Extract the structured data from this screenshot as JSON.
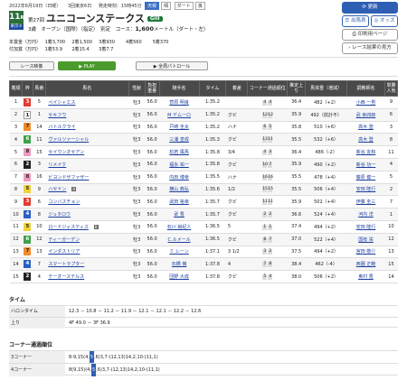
{
  "race_info": {
    "date": "2022年6月19日（日曜）",
    "meeting": "3回東京6日",
    "post_time": "発走時刻：15時45分",
    "weather": "天候",
    "weather_value": "晴",
    "track": "ダート",
    "track_value": "良"
  },
  "race": {
    "number": "11",
    "number_suffix": "R",
    "nth": "第27回",
    "name": "ユニコーンステークス",
    "grade": "GIII",
    "grade_badge": "東京⑤",
    "conditions": "3歳　オープン（国際）（指定）　別定　コース：",
    "distance": "1,600",
    "course_suffix": "メートル（ダート・左）"
  },
  "prize": {
    "row1_label": "本賞金（万円）",
    "row1": [
      "1着",
      "3,700",
      "2着",
      "1,500",
      "3着",
      "930",
      "4着",
      "560",
      "5着",
      "370"
    ],
    "row2_label": "付加賞（万円）",
    "row2": [
      "1着",
      "53.9",
      "2着",
      "15.4",
      "3着",
      "7.7"
    ]
  },
  "buttons": {
    "update": "更新",
    "entries": "出馬表",
    "odds": "オッズ",
    "print": "印刷用ページ",
    "results_howto": "レース結果の見方"
  },
  "tabs": {
    "race_video": "レース映像",
    "play": "PLAY",
    "patrol": "全周パトロール"
  },
  "table_headers": [
    "着順",
    "枠",
    "馬番",
    "馬名",
    "性齢",
    "負担重量",
    "騎手名",
    "タイム",
    "着差",
    "コーナー通過順位",
    "推定上り",
    "馬体重（増減）",
    "調教師名",
    "単勝人気"
  ],
  "results": [
    {
      "pos": "1",
      "waku": "3",
      "num": "5",
      "name": "ペイシャエス",
      "sex": "牡3",
      "wt": "56.0",
      "jockey": "菅原 明良",
      "time": "1:35.2",
      "margin": "",
      "corners": [
        "4",
        "4"
      ],
      "up": "36.4",
      "bw": "482（+2）",
      "trainer": "小西 一男",
      "pop": "9"
    },
    {
      "pos": "2",
      "waku": "1",
      "num": "1",
      "name": "セキフウ",
      "sex": "牡3",
      "wt": "56.0",
      "jockey": "M.デムーロ",
      "time": "1:35.2",
      "margin": "クビ",
      "corners": [
        "12",
        "12"
      ],
      "up": "35.9",
      "bw": "492（前計不）",
      "trainer": "武 幸四郎",
      "pop": "6"
    },
    {
      "pos": "3",
      "waku": "7",
      "num": "14",
      "name": "バトルクライ",
      "sex": "牡3",
      "wt": "56.0",
      "jockey": "戸崎 圭太",
      "time": "1:35.2",
      "margin": "ハナ",
      "corners": [
        "6",
        "5"
      ],
      "up": "35.8",
      "bw": "510（+6）",
      "trainer": "高木 登",
      "pop": "3"
    },
    {
      "pos": "4",
      "waku": "6",
      "num": "11",
      "name": "ヴァルツァーシャル",
      "sex": "牡3",
      "wt": "56.0",
      "jockey": "三浦 皇成",
      "time": "1:35.3",
      "margin": "クビ",
      "corners": [
        "13",
        "11"
      ],
      "up": "35.5",
      "bw": "532（+6）",
      "trainer": "高木 登",
      "pop": "8"
    },
    {
      "pos": "5",
      "waku": "8",
      "num": "15",
      "name": "セイウンオセアン",
      "sex": "牡3",
      "wt": "56.0",
      "jockey": "松若 風馬",
      "time": "1:35.8",
      "margin": "3/4",
      "corners": [
        "4",
        "3"
      ],
      "up": "36.4",
      "bw": "486（-2）",
      "trainer": "新谷 友和",
      "pop": "11"
    },
    {
      "pos": "6",
      "waku": "2",
      "num": "3",
      "name": "リメイク",
      "sex": "牡3",
      "wt": "56.0",
      "jockey": "福永 祐一",
      "time": "1:35.8",
      "margin": "クビ",
      "corners": [
        "10",
        "7"
      ],
      "up": "35.9",
      "bw": "490（+2）",
      "trainer": "新谷 功一",
      "pop": "4"
    },
    {
      "pos": "7",
      "waku": "8",
      "num": "16",
      "name": "ビヨンドザファザー",
      "sex": "牡3",
      "wt": "56.0",
      "jockey": "内田 博幸",
      "time": "1:35.5",
      "margin": "ハナ",
      "corners": [
        "16",
        "16"
      ],
      "up": "35.5",
      "bw": "478（+4）",
      "trainer": "藤原 健一",
      "pop": "5"
    },
    {
      "pos": "8",
      "waku": "5",
      "num": "9",
      "name": "ハセドン",
      "sex": "牡3",
      "wt": "56.0",
      "jockey": "横山 典弘",
      "time": "1:35.6",
      "margin": "1/2",
      "corners": [
        "15",
        "15"
      ],
      "up": "35.5",
      "bw": "506（+4）",
      "trainer": "安田 隆行",
      "pop": "2",
      "blinker": "B"
    },
    {
      "pos": "9",
      "waku": "3",
      "num": "6",
      "name": "コンバスチョン",
      "sex": "牡3",
      "wt": "56.0",
      "jockey": "武田 裕幸",
      "time": "1:35.7",
      "margin": "クビ",
      "corners": [
        "11",
        "11"
      ],
      "up": "35.9",
      "bw": "502（+4）",
      "trainer": "伊藤 圭三",
      "pop": "7"
    },
    {
      "pos": "10",
      "waku": "4",
      "num": "8",
      "name": "ジュタロウ",
      "sex": "牡3",
      "wt": "56.0",
      "jockey": "武 豊",
      "time": "1:35.7",
      "margin": "クビ",
      "corners": [
        "2",
        "2"
      ],
      "up": "36.6",
      "bw": "524（+4）",
      "trainer": "河内 洋",
      "pop": "1"
    },
    {
      "pos": "11",
      "waku": "5",
      "num": "10",
      "name": "ロードジャスティス",
      "sex": "牡3",
      "wt": "56.0",
      "jockey": "石川 裕紀人",
      "time": "1:36.5",
      "margin": "5",
      "corners": [
        "1",
        "1"
      ],
      "up": "37.4",
      "bw": "494（+2）",
      "trainer": "安田 隆行",
      "pop": "10",
      "blinker": "B"
    },
    {
      "pos": "12",
      "waku": "6",
      "num": "12",
      "name": "ティーガーデン",
      "sex": "牡3",
      "wt": "56.0",
      "jockey": "C.ルメール",
      "time": "1:36.5",
      "margin": "クビ",
      "corners": [
        "8",
        "7"
      ],
      "up": "37.0",
      "bw": "522（+4）",
      "trainer": "国枝 栄",
      "pop": "12"
    },
    {
      "pos": "13",
      "waku": "7",
      "num": "13",
      "name": "インダストリア",
      "sex": "牡3",
      "wt": "56.0",
      "jockey": "ミ.レーン",
      "time": "1:37.1",
      "margin": "3 1/2",
      "corners": [
        "3",
        "2"
      ],
      "up": "37.5",
      "bw": "494（+2）",
      "trainer": "宮田 敬介",
      "pop": "13"
    },
    {
      "pos": "14",
      "waku": "4",
      "num": "7",
      "name": "スマートラプター",
      "sex": "牡3",
      "wt": "56.0",
      "jockey": "石橋 脩",
      "time": "1:37.8",
      "margin": "4",
      "corners": [
        "7",
        "8"
      ],
      "up": "38.4",
      "bw": "462（-4）",
      "trainer": "西園 正範",
      "pop": "15"
    },
    {
      "pos": "15",
      "waku": "2",
      "num": "4",
      "name": "テーオーステルス",
      "sex": "牡3",
      "wt": "56.0",
      "jockey": "団野 大成",
      "time": "1:37.8",
      "margin": "クビ",
      "corners": [
        "5",
        "4"
      ],
      "up": "38.0",
      "bw": "506（+2）",
      "trainer": "奥村 豊",
      "pop": "14"
    }
  ],
  "waku_colors": {
    "1": "#ffffff",
    "2": "#222222",
    "3": "#e33c2f",
    "4": "#2b5fc6",
    "5": "#f0d23a",
    "6": "#3ea14a",
    "7": "#f28a2c",
    "8": "#f09ac0"
  },
  "timing": {
    "title": "タイム",
    "halon_label": "ハロンタイム",
    "halon": "12.3 － 10.8 － 11.2 － 11.9 － 12.1 － 12.1 － 12.2 － 12.6",
    "up_label": "上り",
    "up": "4F 49.0 － 3F 36.9"
  },
  "corners": {
    "title": "コーナー通過順位",
    "c3_label": "3コーナー",
    "c3_pre": "8-9,15(4,",
    "c3_hl": "5",
    "c3_post": ",6)3,7-(12,13)14,2,10-(11,1)",
    "c4_label": "4コーナー",
    "c4_pre": "8(9,15)(4,",
    "c4_hl": "5",
    "c4_post": ",6)3,7-(12,13)14,2,10-(11,1)"
  }
}
